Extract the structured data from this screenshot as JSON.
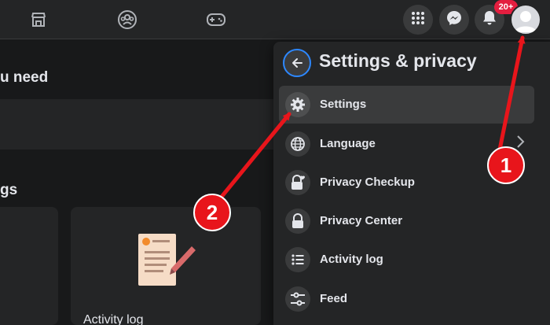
{
  "topbar": {
    "nav_icons": [
      "marketplace-icon",
      "groups-icon",
      "gaming-icon"
    ],
    "right_icons": [
      "menu-grid-icon",
      "messenger-icon",
      "notifications-icon"
    ],
    "notification_badge": "20+"
  },
  "background": {
    "heading_1": "u need",
    "heading_2": "gs",
    "card_label": "Activity log"
  },
  "dropdown": {
    "title": "Settings & privacy",
    "items": [
      {
        "label": "Settings",
        "icon": "gear-icon",
        "active": true
      },
      {
        "label": "Language",
        "icon": "globe-icon"
      },
      {
        "label": "Privacy Checkup",
        "icon": "lock-heart-icon"
      },
      {
        "label": "Privacy Center",
        "icon": "lock-icon"
      },
      {
        "label": "Activity log",
        "icon": "list-icon"
      },
      {
        "label": "Feed",
        "icon": "sliders-icon"
      }
    ]
  },
  "annotations": {
    "step_1": "1",
    "step_2": "2",
    "color": "#e8151b"
  },
  "colors": {
    "background": "#18191a",
    "surface": "#242526",
    "accent": "#2d88ff",
    "badge": "#e41e3f"
  }
}
